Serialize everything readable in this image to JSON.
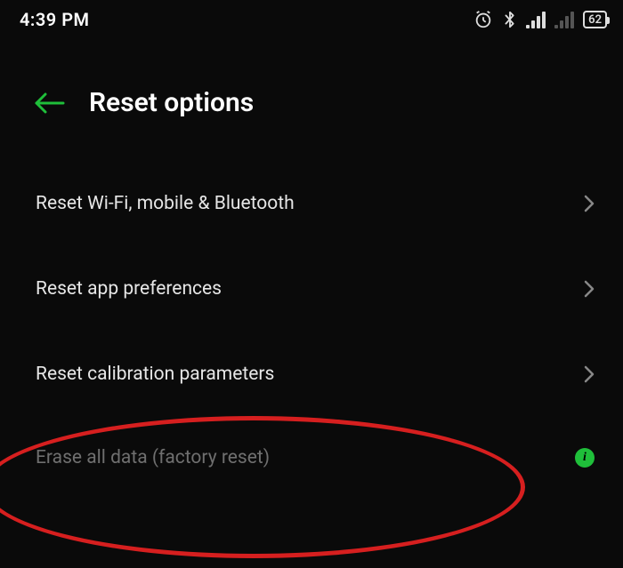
{
  "status": {
    "time": "4:39 PM",
    "battery": "62"
  },
  "header": {
    "title": "Reset options"
  },
  "rows": {
    "wifi": "Reset Wi-Fi, mobile & Bluetooth",
    "app_prefs": "Reset app preferences",
    "calibration": "Reset calibration parameters",
    "erase": "Erase all data (factory reset)"
  },
  "info_glyph": "i"
}
